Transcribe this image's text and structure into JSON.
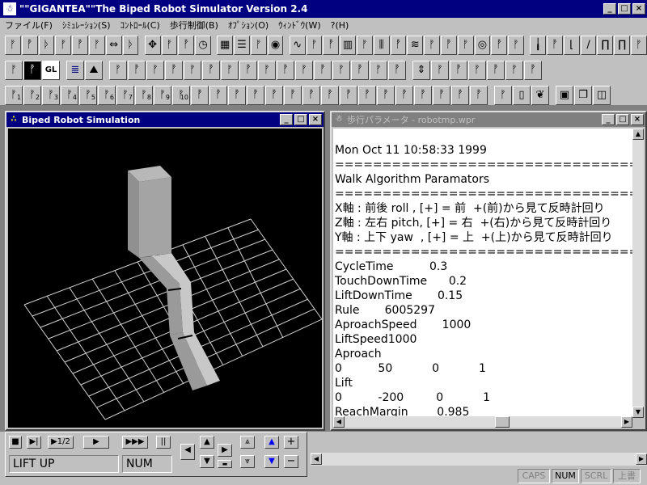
{
  "window": {
    "title": "\"\"GIGANTEA\"\"The Biped Robot Simulator Version 2.4",
    "min": "_",
    "max": "□",
    "close": "×"
  },
  "menu": [
    "ファイル(F)",
    "ｼﾐｭﾚｰｼｮﾝ(S)",
    "ｺﾝﾄﾛｰﾙ(C)",
    "歩行制御(B)",
    "ｵﾌﾟｼｮﾝ(O)",
    "ｳｨﾝﾄﾞｳ(W)",
    "?(H)"
  ],
  "toolbar3_numbers": [
    "1",
    "2",
    "3",
    "4",
    "5",
    "6",
    "7",
    "8",
    "9",
    "10"
  ],
  "toolbar2_gl": "GL",
  "sim_window": {
    "title": "Biped Robot Simulation"
  },
  "param_window": {
    "title": "歩行パラメータ - robotmp.wpr",
    "lines": [
      "Mon Oct 11 10:58:33 1999",
      "=========================================",
      "Walk Algorithm Paramators",
      "=========================================",
      "X軸 : 前後 roll , [+] = 前  +(前)から見て反時計回り",
      "Z軸 : 左右 pitch, [+] = 右  +(右)から見て反時計回り",
      "Y軸 : 上下 yaw  , [+] = 上  +(上)から見て反時計回り",
      "=========================================",
      "CycleTime          0.3",
      "TouchDownTime      0.2",
      "LiftDownTime       0.15",
      "Rule       6005297",
      "AproachSpeed       1000",
      "LiftSpeed1000",
      "Aproach",
      "0          50           0           1",
      "Lift",
      "0          -200         0           1",
      "ReachMargin        0.985"
    ]
  },
  "controls": {
    "stop": "■",
    "step": "▶|",
    "half": "▶1/2",
    "play": "▶",
    "fast": "▶▶▶",
    "pause": "||",
    "left": "◀",
    "up": "▲",
    "down": "▼",
    "right": "▶",
    "dash": "▬",
    "up2": "⩓",
    "down2": "⩔",
    "blue_up": "▲",
    "blue_down": "▼",
    "plus": "+",
    "minus": "−",
    "status_text": "LIFT UP",
    "num_text": "NUM"
  },
  "statusbar": {
    "caps": "CAPS",
    "num": "NUM",
    "scrl": "SCRL",
    "ins": "上書"
  }
}
